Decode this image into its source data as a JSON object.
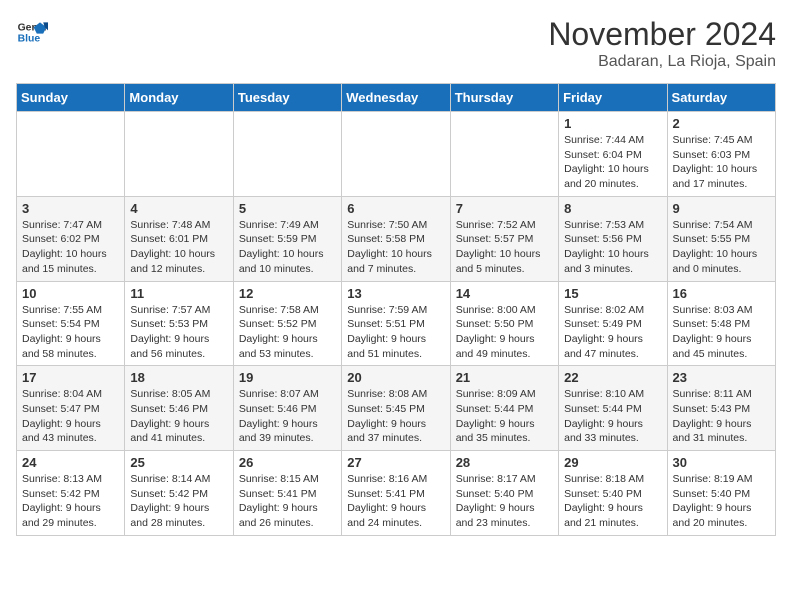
{
  "header": {
    "logo_line1": "General",
    "logo_line2": "Blue",
    "month": "November 2024",
    "location": "Badaran, La Rioja, Spain"
  },
  "days_of_week": [
    "Sunday",
    "Monday",
    "Tuesday",
    "Wednesday",
    "Thursday",
    "Friday",
    "Saturday"
  ],
  "weeks": [
    [
      {
        "day": "",
        "info": ""
      },
      {
        "day": "",
        "info": ""
      },
      {
        "day": "",
        "info": ""
      },
      {
        "day": "",
        "info": ""
      },
      {
        "day": "",
        "info": ""
      },
      {
        "day": "1",
        "info": "Sunrise: 7:44 AM\nSunset: 6:04 PM\nDaylight: 10 hours\nand 20 minutes."
      },
      {
        "day": "2",
        "info": "Sunrise: 7:45 AM\nSunset: 6:03 PM\nDaylight: 10 hours\nand 17 minutes."
      }
    ],
    [
      {
        "day": "3",
        "info": "Sunrise: 7:47 AM\nSunset: 6:02 PM\nDaylight: 10 hours\nand 15 minutes."
      },
      {
        "day": "4",
        "info": "Sunrise: 7:48 AM\nSunset: 6:01 PM\nDaylight: 10 hours\nand 12 minutes."
      },
      {
        "day": "5",
        "info": "Sunrise: 7:49 AM\nSunset: 5:59 PM\nDaylight: 10 hours\nand 10 minutes."
      },
      {
        "day": "6",
        "info": "Sunrise: 7:50 AM\nSunset: 5:58 PM\nDaylight: 10 hours\nand 7 minutes."
      },
      {
        "day": "7",
        "info": "Sunrise: 7:52 AM\nSunset: 5:57 PM\nDaylight: 10 hours\nand 5 minutes."
      },
      {
        "day": "8",
        "info": "Sunrise: 7:53 AM\nSunset: 5:56 PM\nDaylight: 10 hours\nand 3 minutes."
      },
      {
        "day": "9",
        "info": "Sunrise: 7:54 AM\nSunset: 5:55 PM\nDaylight: 10 hours\nand 0 minutes."
      }
    ],
    [
      {
        "day": "10",
        "info": "Sunrise: 7:55 AM\nSunset: 5:54 PM\nDaylight: 9 hours\nand 58 minutes."
      },
      {
        "day": "11",
        "info": "Sunrise: 7:57 AM\nSunset: 5:53 PM\nDaylight: 9 hours\nand 56 minutes."
      },
      {
        "day": "12",
        "info": "Sunrise: 7:58 AM\nSunset: 5:52 PM\nDaylight: 9 hours\nand 53 minutes."
      },
      {
        "day": "13",
        "info": "Sunrise: 7:59 AM\nSunset: 5:51 PM\nDaylight: 9 hours\nand 51 minutes."
      },
      {
        "day": "14",
        "info": "Sunrise: 8:00 AM\nSunset: 5:50 PM\nDaylight: 9 hours\nand 49 minutes."
      },
      {
        "day": "15",
        "info": "Sunrise: 8:02 AM\nSunset: 5:49 PM\nDaylight: 9 hours\nand 47 minutes."
      },
      {
        "day": "16",
        "info": "Sunrise: 8:03 AM\nSunset: 5:48 PM\nDaylight: 9 hours\nand 45 minutes."
      }
    ],
    [
      {
        "day": "17",
        "info": "Sunrise: 8:04 AM\nSunset: 5:47 PM\nDaylight: 9 hours\nand 43 minutes."
      },
      {
        "day": "18",
        "info": "Sunrise: 8:05 AM\nSunset: 5:46 PM\nDaylight: 9 hours\nand 41 minutes."
      },
      {
        "day": "19",
        "info": "Sunrise: 8:07 AM\nSunset: 5:46 PM\nDaylight: 9 hours\nand 39 minutes."
      },
      {
        "day": "20",
        "info": "Sunrise: 8:08 AM\nSunset: 5:45 PM\nDaylight: 9 hours\nand 37 minutes."
      },
      {
        "day": "21",
        "info": "Sunrise: 8:09 AM\nSunset: 5:44 PM\nDaylight: 9 hours\nand 35 minutes."
      },
      {
        "day": "22",
        "info": "Sunrise: 8:10 AM\nSunset: 5:44 PM\nDaylight: 9 hours\nand 33 minutes."
      },
      {
        "day": "23",
        "info": "Sunrise: 8:11 AM\nSunset: 5:43 PM\nDaylight: 9 hours\nand 31 minutes."
      }
    ],
    [
      {
        "day": "24",
        "info": "Sunrise: 8:13 AM\nSunset: 5:42 PM\nDaylight: 9 hours\nand 29 minutes."
      },
      {
        "day": "25",
        "info": "Sunrise: 8:14 AM\nSunset: 5:42 PM\nDaylight: 9 hours\nand 28 minutes."
      },
      {
        "day": "26",
        "info": "Sunrise: 8:15 AM\nSunset: 5:41 PM\nDaylight: 9 hours\nand 26 minutes."
      },
      {
        "day": "27",
        "info": "Sunrise: 8:16 AM\nSunset: 5:41 PM\nDaylight: 9 hours\nand 24 minutes."
      },
      {
        "day": "28",
        "info": "Sunrise: 8:17 AM\nSunset: 5:40 PM\nDaylight: 9 hours\nand 23 minutes."
      },
      {
        "day": "29",
        "info": "Sunrise: 8:18 AM\nSunset: 5:40 PM\nDaylight: 9 hours\nand 21 minutes."
      },
      {
        "day": "30",
        "info": "Sunrise: 8:19 AM\nSunset: 5:40 PM\nDaylight: 9 hours\nand 20 minutes."
      }
    ]
  ]
}
